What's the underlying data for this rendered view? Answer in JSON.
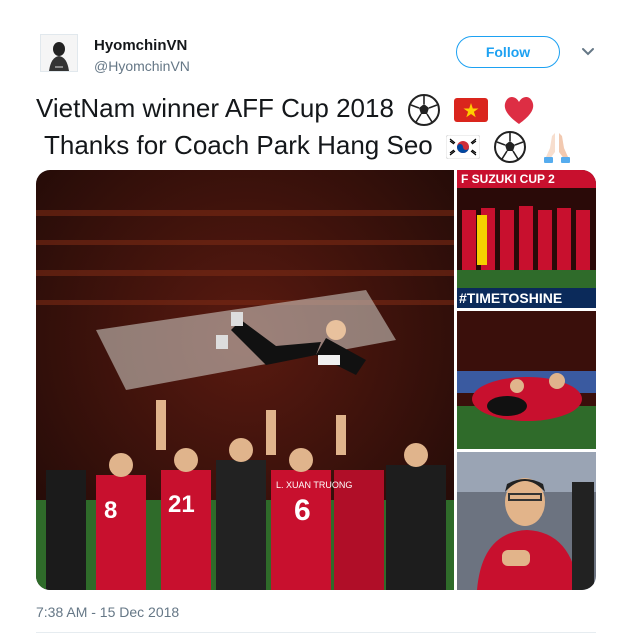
{
  "user": {
    "display_name": "HyomchinVN",
    "handle": "@HyomchinVN",
    "avatar_icon": "profile-photo"
  },
  "follow_button": {
    "label": "Follow"
  },
  "menu_icon": "chevron-down-icon",
  "tweet": {
    "line1": "VietNam winner AFF Cup 2018",
    "line1_emoji": [
      "soccer-ball",
      "vietnam-flag",
      "red-heart"
    ],
    "line2": "Thanks for Coach Park Hang Seo",
    "line2_emoji": [
      "south-korea-flag",
      "soccer-ball",
      "folded-hands"
    ],
    "timestamp": "7:38 AM - 15 Dec 2018"
  },
  "media": {
    "photo2_banner_top": "F SUZUKI CUP 2",
    "photo2_banner_bottom": "#TIMETOSHINE",
    "player_numbers": [
      "8",
      "21",
      "6"
    ],
    "player_name": "L. XUAN TRUONG"
  },
  "colors": {
    "accent": "#1da1f2",
    "team_red": "#c8102e",
    "pitch": "#2f6b2a"
  }
}
